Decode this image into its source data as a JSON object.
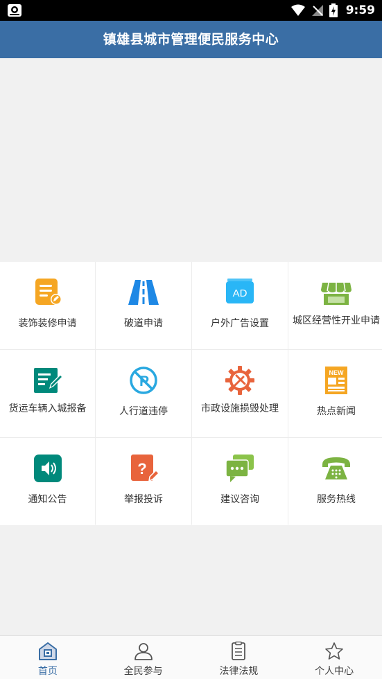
{
  "status_bar": {
    "time": "9:59"
  },
  "header": {
    "title": "镇雄县城市管理便民服务中心"
  },
  "services": [
    {
      "label": "装饰装修申请",
      "icon": "renovation-document-icon"
    },
    {
      "label": "破道申请",
      "icon": "road-icon"
    },
    {
      "label": "户外广告设置",
      "icon": "ad-board-icon"
    },
    {
      "label": "城区经营性开业申请",
      "icon": "storefront-icon"
    },
    {
      "label": "货运车辆入城报备",
      "icon": "edit-note-icon"
    },
    {
      "label": "人行道违停",
      "icon": "no-parking-icon"
    },
    {
      "label": "市政设施损毁处理",
      "icon": "repair-gear-icon"
    },
    {
      "label": "热点新闻",
      "icon": "news-icon"
    },
    {
      "label": "通知公告",
      "icon": "speaker-icon"
    },
    {
      "label": "举报投诉",
      "icon": "complaint-icon"
    },
    {
      "label": "建议咨询",
      "icon": "chat-bubbles-icon"
    },
    {
      "label": "服务热线",
      "icon": "telephone-icon"
    }
  ],
  "tabs": [
    {
      "label": "首页",
      "icon": "home-icon",
      "active": true
    },
    {
      "label": "全民参与",
      "icon": "person-icon",
      "active": false
    },
    {
      "label": "法律法规",
      "icon": "document-icon",
      "active": false
    },
    {
      "label": "个人中心",
      "icon": "star-icon",
      "active": false
    }
  ],
  "colors": {
    "header": "#3a6ea5",
    "orange": "#f5a623",
    "blue": "#1e88e5",
    "sky": "#29b6f6",
    "green": "#7cb342",
    "teal": "#00897b",
    "red": "#e64a19",
    "tab_active": "#3a6ea5"
  }
}
